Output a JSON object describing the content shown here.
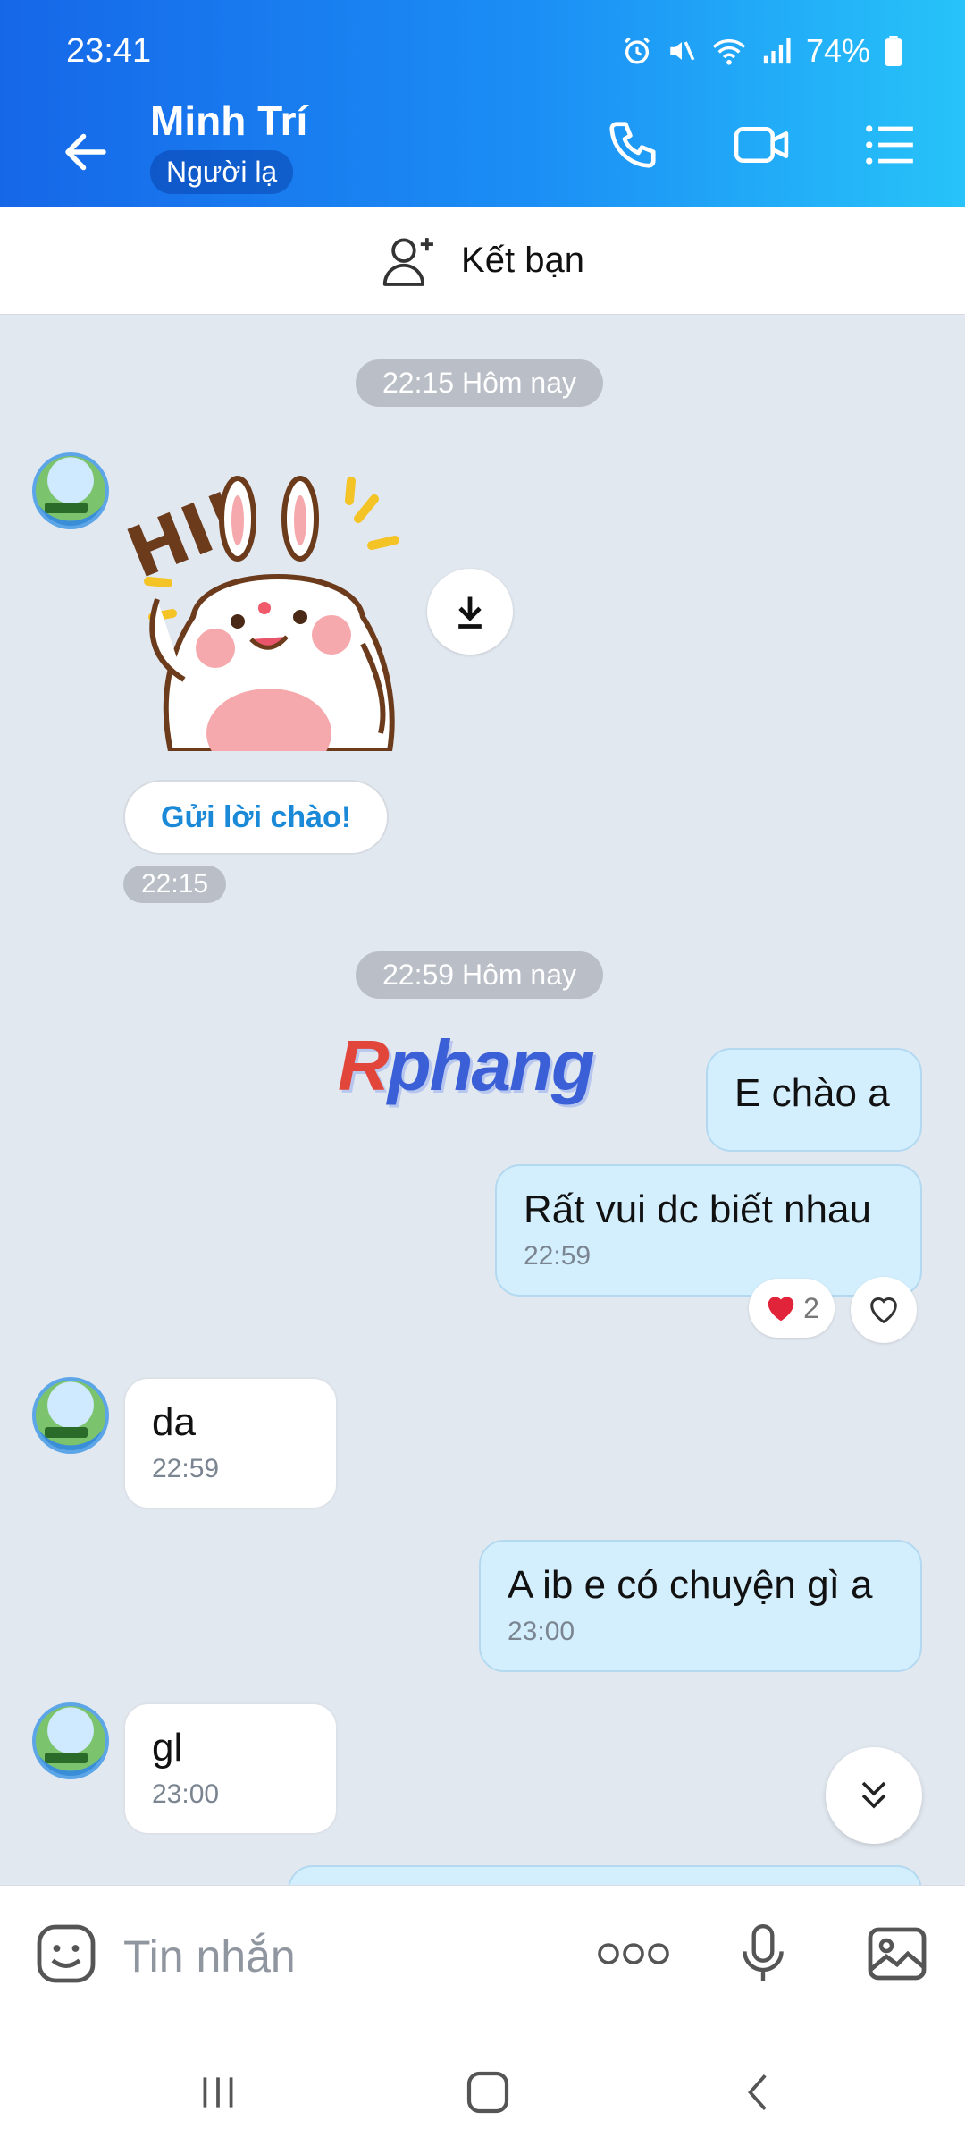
{
  "status": {
    "time": "23:41",
    "battery": "74%"
  },
  "contact": {
    "name": "Minh Trí",
    "badge": "Người lạ"
  },
  "friend_strip": {
    "label": "Kết bạn"
  },
  "chips": {
    "first": "22:15 Hôm nay",
    "second": "22:59 Hôm nay"
  },
  "sticker": {
    "text": "HI!",
    "time": "22:15"
  },
  "greet_button": "Gửi lời chào!",
  "watermark": {
    "first": "R",
    "rest": "phang"
  },
  "messages": [
    {
      "text": "E chào a"
    },
    {
      "text": "Rất vui dc biết nhau",
      "time": "22:59"
    },
    {
      "text": "da",
      "time": "22:59"
    },
    {
      "text": "A ib e có chuyện gì a",
      "time": "23:00"
    },
    {
      "text": "gl",
      "time": "23:00"
    }
  ],
  "reaction": {
    "count": "2"
  },
  "composer": {
    "placeholder": "Tin nhắn"
  }
}
